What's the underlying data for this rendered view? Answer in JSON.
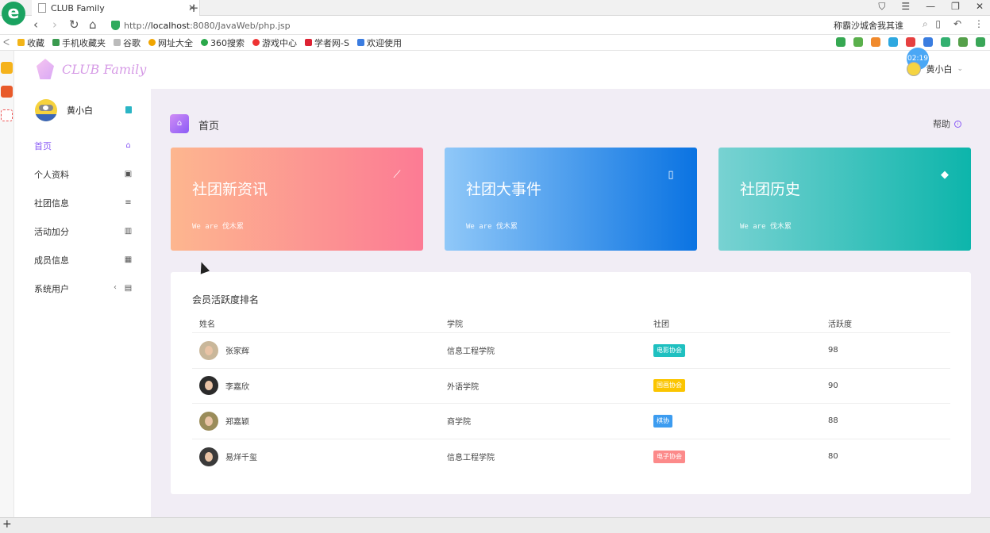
{
  "browser": {
    "tab_title": "CLUB Family",
    "url_prefix": "http://",
    "url_host": "localhost",
    "url_rest": ":8080/JavaWeb/php.jsp",
    "search_text": "称霸沙城舍我其谁",
    "bookmarks": [
      "收藏",
      "手机收藏夹",
      "谷歌",
      "网址大全",
      "360搜索",
      "游戏中心",
      "学者网-S",
      "欢迎使用"
    ],
    "bookmark_colors": [
      "#f2b418",
      "#3a9a4f",
      "#aaa",
      "#f0a500",
      "#2aa84a",
      "#e33",
      "#d23",
      "#3b7ce0"
    ]
  },
  "header": {
    "logo_text": "CLUB Family",
    "time_badge": "02:19",
    "user_name": "黄小白"
  },
  "sidebar": {
    "user_name": "黄小白",
    "items": [
      {
        "label": "首页",
        "icon": "home-icon",
        "glyph": "⌂"
      },
      {
        "label": "个人资料",
        "icon": "id-card-icon",
        "glyph": "▣"
      },
      {
        "label": "社团信息",
        "icon": "list-icon",
        "glyph": "≡"
      },
      {
        "label": "活动加分",
        "icon": "bar-chart-icon",
        "glyph": "▥"
      },
      {
        "label": "成员信息",
        "icon": "grid-icon",
        "glyph": "▦"
      },
      {
        "label": "系统用户",
        "icon": "briefcase-icon",
        "glyph": "▤"
      }
    ]
  },
  "main": {
    "page_title": "首页",
    "help_label": "帮助",
    "cards": [
      {
        "title": "社团新资讯",
        "subtitle": "We are 伐木累",
        "icon": "line-chart-icon",
        "glyph": "⟋"
      },
      {
        "title": "社团大事件",
        "subtitle": "We are 伐木累",
        "icon": "bookmark-icon",
        "glyph": "▯"
      },
      {
        "title": "社团历史",
        "subtitle": "We are 伐木累",
        "icon": "diamond-icon",
        "glyph": "◆"
      }
    ],
    "table": {
      "title": "会员活跃度排名",
      "headers": [
        "姓名",
        "学院",
        "社团",
        "活跃度"
      ],
      "rows": [
        {
          "name": "张家辉",
          "college": "信息工程学院",
          "club": "电影协会",
          "club_color": "#1fc0c0",
          "score": "98"
        },
        {
          "name": "李嘉欣",
          "college": "外语学院",
          "club": "国画协会",
          "club_color": "#fbc500",
          "score": "90"
        },
        {
          "name": "郑嘉颖",
          "college": "商学院",
          "club": "棋协",
          "club_color": "#3c9cf0",
          "score": "88"
        },
        {
          "name": "易烊千玺",
          "college": "信息工程学院",
          "club": "电子协会",
          "club_color": "#fc8a8a",
          "score": "80"
        }
      ]
    }
  }
}
